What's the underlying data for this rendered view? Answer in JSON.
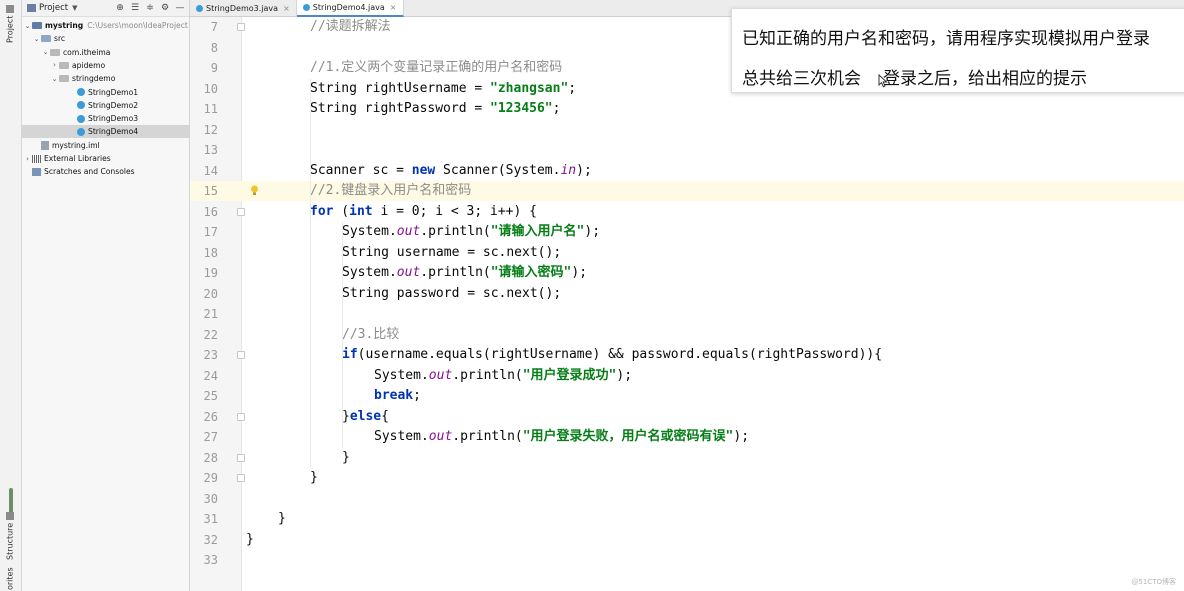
{
  "tool_strip": {
    "project_tab": "Project",
    "structure_tab": "Structure",
    "favorites_tab": "orites"
  },
  "project_panel": {
    "title": "Project",
    "tree": [
      {
        "label": "mystring",
        "hint": "C:\\Users\\moon\\IdeaProject",
        "kind": "module",
        "expanded": true
      },
      {
        "label": "src",
        "kind": "folder",
        "expanded": true
      },
      {
        "label": "com.itheima",
        "kind": "package",
        "expanded": true
      },
      {
        "label": "apidemo",
        "kind": "package",
        "expanded": false
      },
      {
        "label": "stringdemo",
        "kind": "package",
        "expanded": true
      },
      {
        "label": "StringDemo1",
        "kind": "class"
      },
      {
        "label": "StringDemo2",
        "kind": "class"
      },
      {
        "label": "StringDemo3",
        "kind": "class"
      },
      {
        "label": "StringDemo4",
        "kind": "class",
        "selected": true
      },
      {
        "label": "mystring.iml",
        "kind": "file"
      },
      {
        "label": "External Libraries",
        "kind": "library",
        "expanded": false
      },
      {
        "label": "Scratches and Consoles",
        "kind": "scratch"
      }
    ]
  },
  "tabs": [
    {
      "label": "StringDemo3.java",
      "active": false
    },
    {
      "label": "StringDemo4.java",
      "active": true
    }
  ],
  "editor": {
    "highlighted_line": 15,
    "lines": [
      {
        "n": "7",
        "indent": 2,
        "t": "//读题拆解法"
      },
      {
        "n": "8",
        "indent": 0,
        "t": ""
      },
      {
        "n": "9",
        "indent": 2,
        "t": "//1.定义两个变量记录正确的用户名和密码"
      },
      {
        "n": "10",
        "indent": 2,
        "t": "String rightUsername = \"zhangsan\";"
      },
      {
        "n": "11",
        "indent": 2,
        "t": "String rightPassword = \"123456\";"
      },
      {
        "n": "12",
        "indent": 0,
        "t": ""
      },
      {
        "n": "13",
        "indent": 0,
        "t": ""
      },
      {
        "n": "14",
        "indent": 2,
        "t": "Scanner sc = new Scanner(System.in);"
      },
      {
        "n": "15",
        "indent": 2,
        "t": "//2.键盘录入用户名和密码"
      },
      {
        "n": "16",
        "indent": 2,
        "t": "for (int i = 0; i < 3; i++) {"
      },
      {
        "n": "17",
        "indent": 3,
        "t": "System.out.println(\"请输入用户名\");"
      },
      {
        "n": "18",
        "indent": 3,
        "t": "String username = sc.next();"
      },
      {
        "n": "19",
        "indent": 3,
        "t": "System.out.println(\"请输入密码\");"
      },
      {
        "n": "20",
        "indent": 3,
        "t": "String password = sc.next();"
      },
      {
        "n": "21",
        "indent": 0,
        "t": ""
      },
      {
        "n": "22",
        "indent": 3,
        "t": "//3.比较"
      },
      {
        "n": "23",
        "indent": 3,
        "t": "if(username.equals(rightUsername) && password.equals(rightPassword)){"
      },
      {
        "n": "24",
        "indent": 4,
        "t": "System.out.println(\"用户登录成功\");"
      },
      {
        "n": "25",
        "indent": 4,
        "t": "break;"
      },
      {
        "n": "26",
        "indent": 3,
        "t": "}else{"
      },
      {
        "n": "27",
        "indent": 4,
        "t": "System.out.println(\"用户登录失败，用户名或密码有误\");"
      },
      {
        "n": "28",
        "indent": 3,
        "t": "}"
      },
      {
        "n": "29",
        "indent": 2,
        "t": "}"
      },
      {
        "n": "30",
        "indent": 0,
        "t": ""
      },
      {
        "n": "31",
        "indent": 1,
        "t": "}"
      },
      {
        "n": "32",
        "indent": 0,
        "t": "}"
      },
      {
        "n": "33",
        "indent": 0,
        "t": ""
      }
    ]
  },
  "note": {
    "line1": "已知正确的用户名和密码，请用程序实现模拟用户登录",
    "line2a": "总共给三次机会",
    "line2b": "登录之后，给出相应的提示"
  },
  "watermark": "@51CTO博客",
  "icons": {
    "bulb": "intention-bulb-icon",
    "cursor": "mouse-cursor-icon"
  },
  "colors": {
    "keyword": "#0033b3",
    "string": "#067d17",
    "comment": "#8c8c8c",
    "field": "#871094",
    "highlight": "#fffae3"
  }
}
